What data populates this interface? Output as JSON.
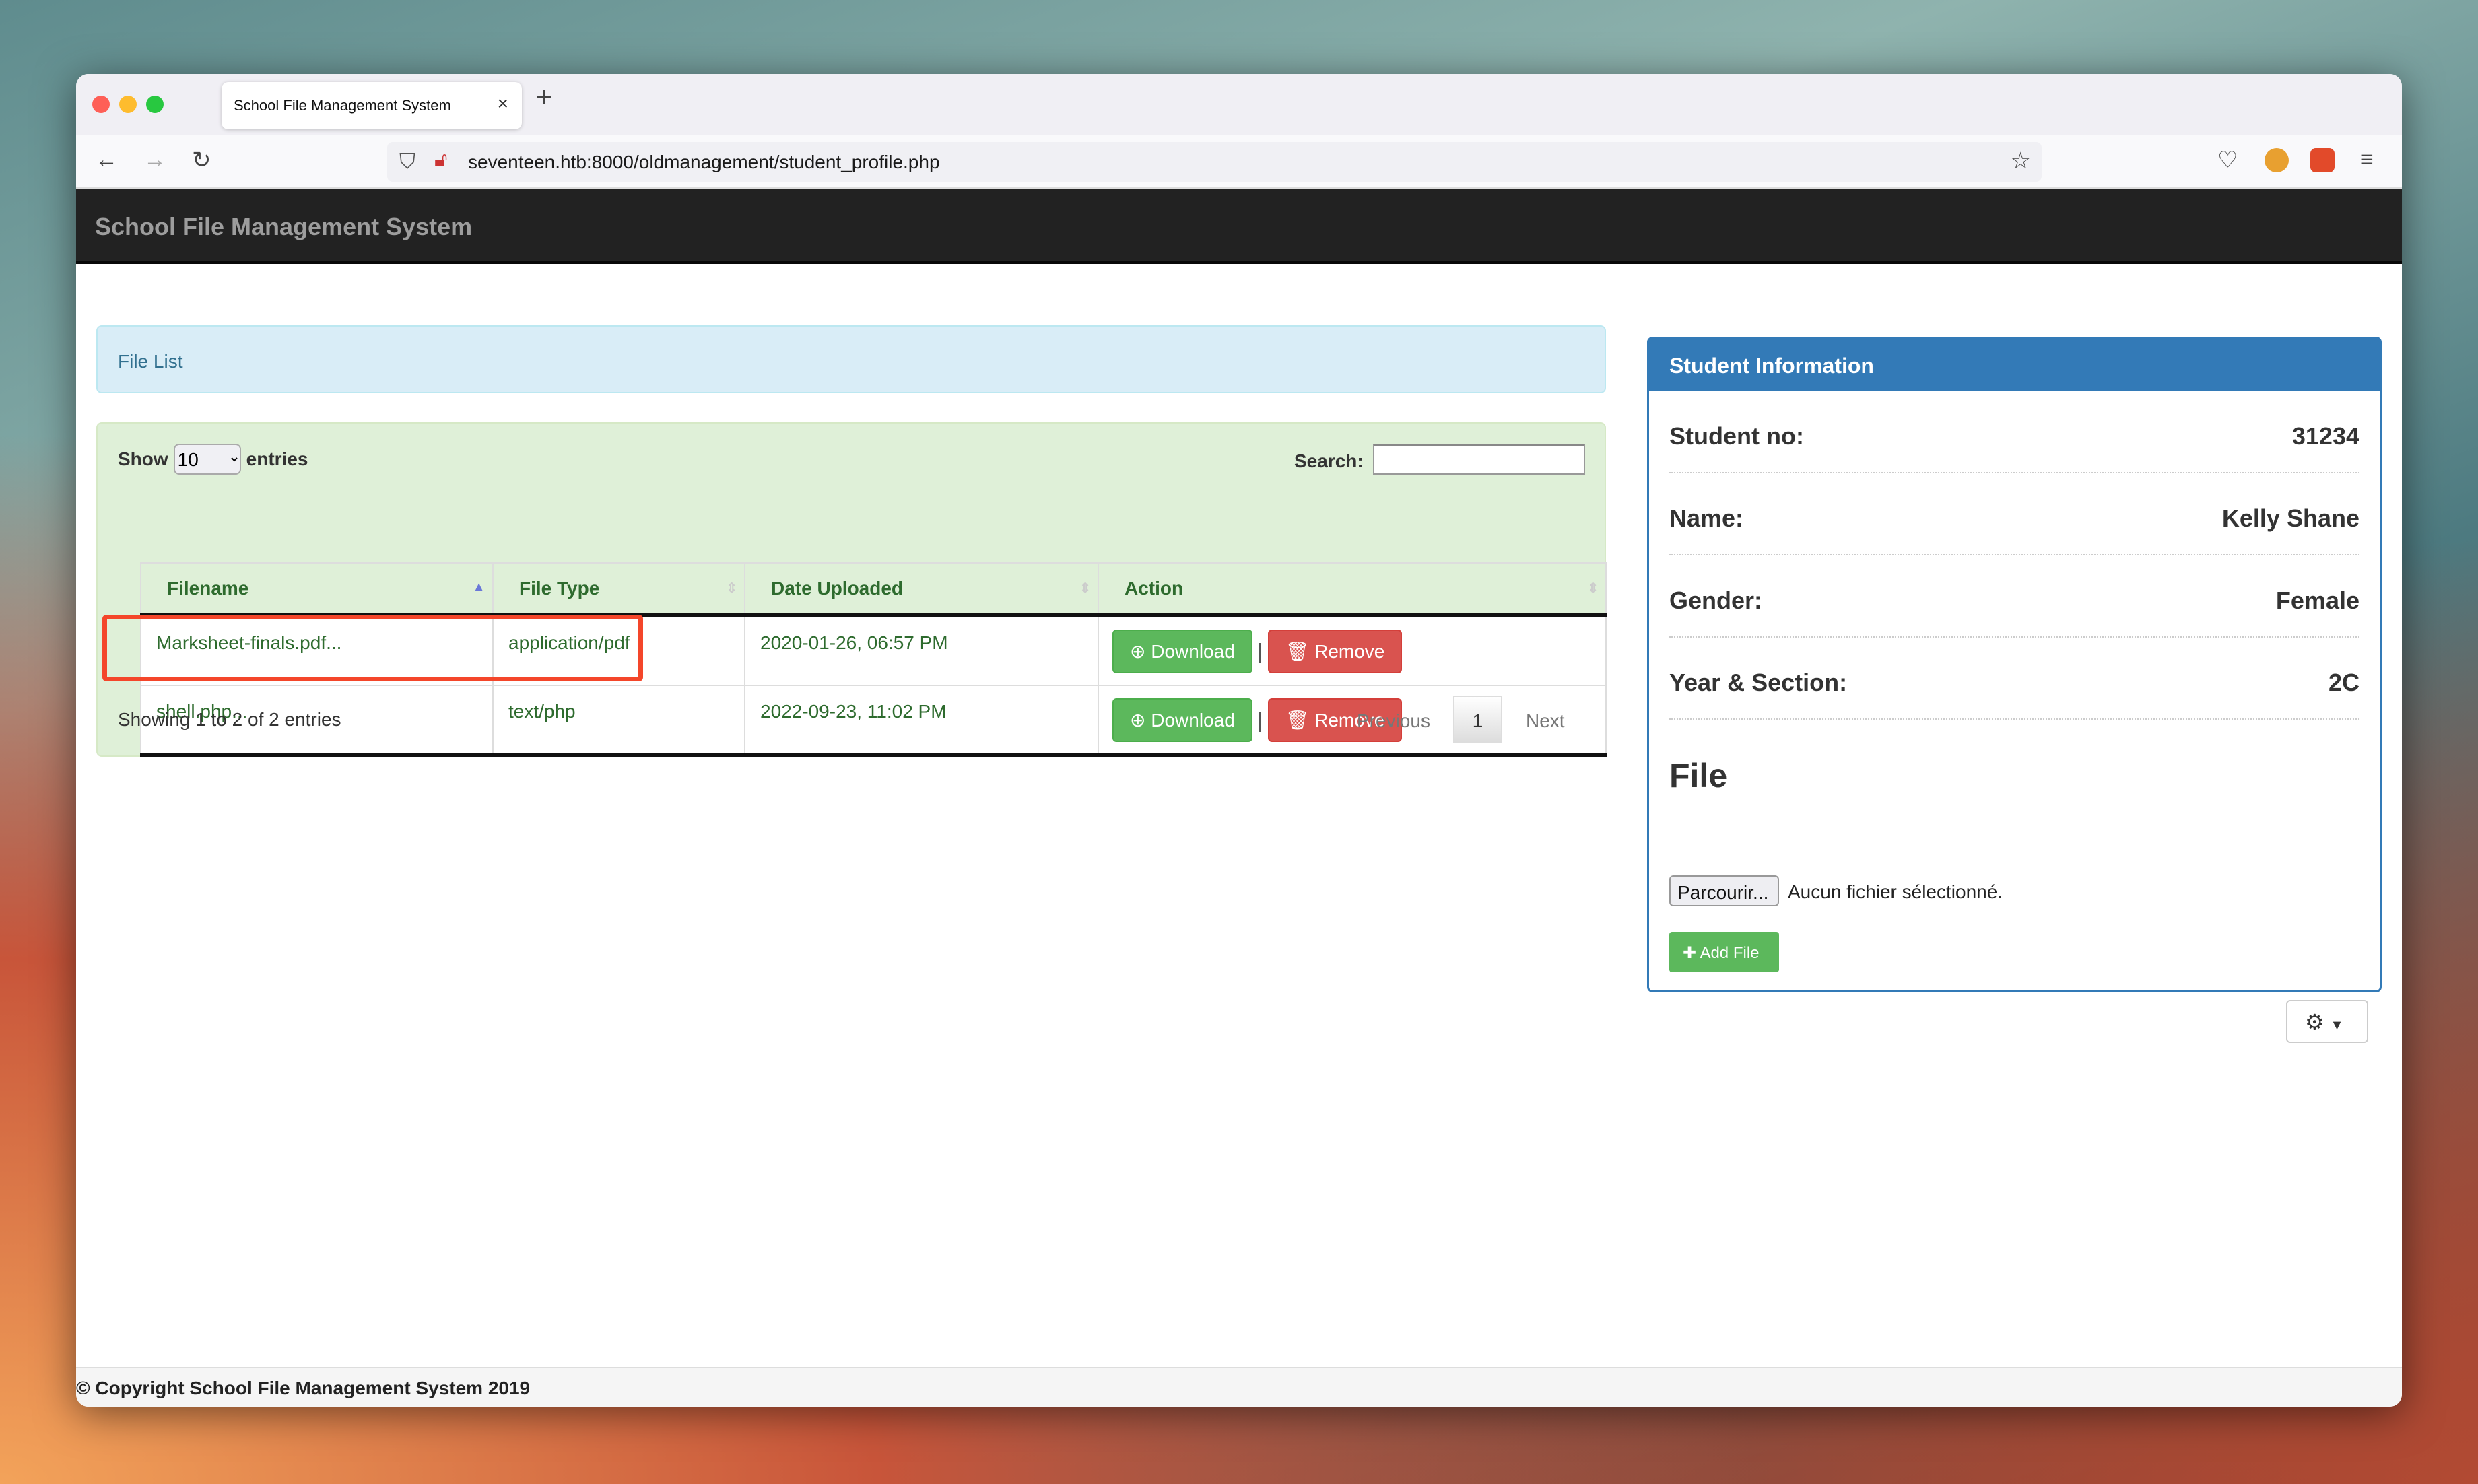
{
  "browser": {
    "tab_title": "School File Management System",
    "url": "seventeen.htb:8000/oldmanagement/student_profile.php"
  },
  "app": {
    "title": "School File Management System"
  },
  "file_list": {
    "heading": "File List",
    "show_label": "Show",
    "entries_label": "entries",
    "page_length": "10",
    "search_label": "Search:",
    "search_value": "",
    "columns": [
      "Filename",
      "File Type",
      "Date Uploaded",
      "Action"
    ],
    "rows": [
      {
        "filename": "Marksheet-finals.pdf...",
        "type": "application/pdf",
        "date": "2020-01-26, 06:57 PM"
      },
      {
        "filename": "shell.php...",
        "type": "text/php",
        "date": "2022-09-23, 11:02 PM"
      }
    ],
    "download_label": "Download",
    "remove_label": "Remove",
    "info": "Showing 1 to 2 of 2 entries",
    "prev": "Previous",
    "page": "1",
    "next": "Next",
    "highlight_color": "#f4462a"
  },
  "student": {
    "heading": "Student Information",
    "fields": [
      {
        "label": "Student no:",
        "value": "31234"
      },
      {
        "label": "Name:",
        "value": "Kelly Shane"
      },
      {
        "label": "Gender:",
        "value": "Female"
      },
      {
        "label": "Year & Section:",
        "value": "2C"
      }
    ],
    "file_heading": "File",
    "browse_label": "Parcourir...",
    "no_file": "Aucun fichier sélectionné.",
    "add_file": "Add File"
  },
  "footer": {
    "text": "© Copyright School File Management System 2019"
  },
  "colors": {
    "primary": "#337ab7",
    "success": "#5cb85c",
    "danger": "#d9534f",
    "navbar": "#222222"
  }
}
